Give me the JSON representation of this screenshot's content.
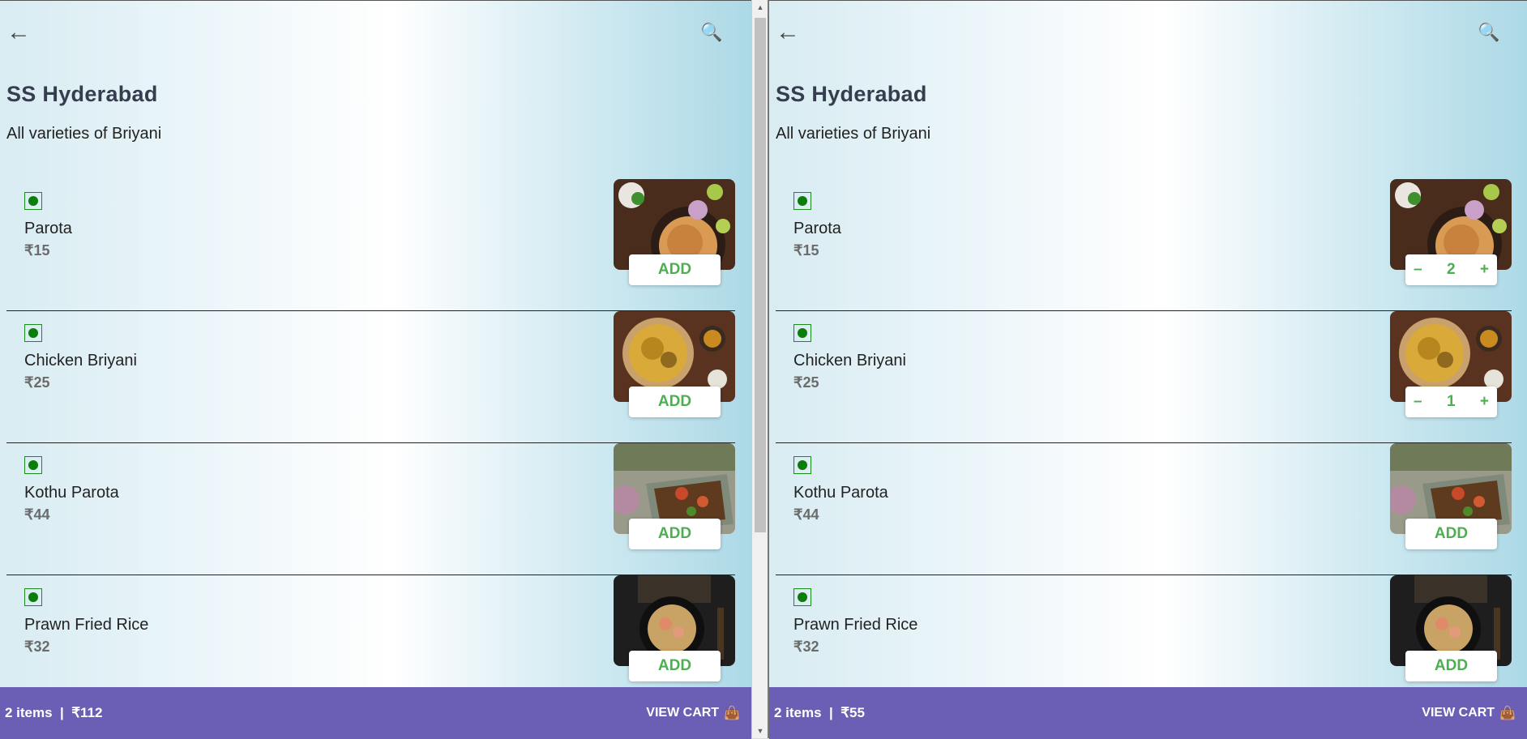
{
  "icons": {
    "back": "←",
    "search": "🔍",
    "cart": "👜"
  },
  "colors": {
    "cart_bar": "#6b5fb5",
    "add_green": "#4caf50",
    "veg_green": "#0a7d0a",
    "title": "#363d4f"
  },
  "panes": [
    {
      "store_name": "SS Hyderabad",
      "tagline": "All varieties of Briyani",
      "items": [
        {
          "name": "Parota",
          "price": "₹15",
          "button": "ADD"
        },
        {
          "name": "Chicken Briyani",
          "price": "₹25",
          "button": "ADD"
        },
        {
          "name": "Kothu Parota",
          "price": "₹44",
          "button": "ADD"
        },
        {
          "name": "Prawn Fried Rice",
          "price": "₹32",
          "button": "ADD"
        }
      ],
      "cart": {
        "summary": "2 items  |  ₹112",
        "action": "VIEW CART"
      }
    },
    {
      "store_name": "SS Hyderabad",
      "tagline": "All varieties of Briyani",
      "items": [
        {
          "name": "Parota",
          "price": "₹15",
          "qty": "2",
          "minus": "–",
          "plus": "+"
        },
        {
          "name": "Chicken Briyani",
          "price": "₹25",
          "qty": "1",
          "minus": "–",
          "plus": "+"
        },
        {
          "name": "Kothu Parota",
          "price": "₹44",
          "button": "ADD"
        },
        {
          "name": "Prawn Fried Rice",
          "price": "₹32",
          "button": "ADD"
        }
      ],
      "cart": {
        "summary": "2 items  |  ₹55",
        "action": "VIEW CART"
      }
    }
  ]
}
